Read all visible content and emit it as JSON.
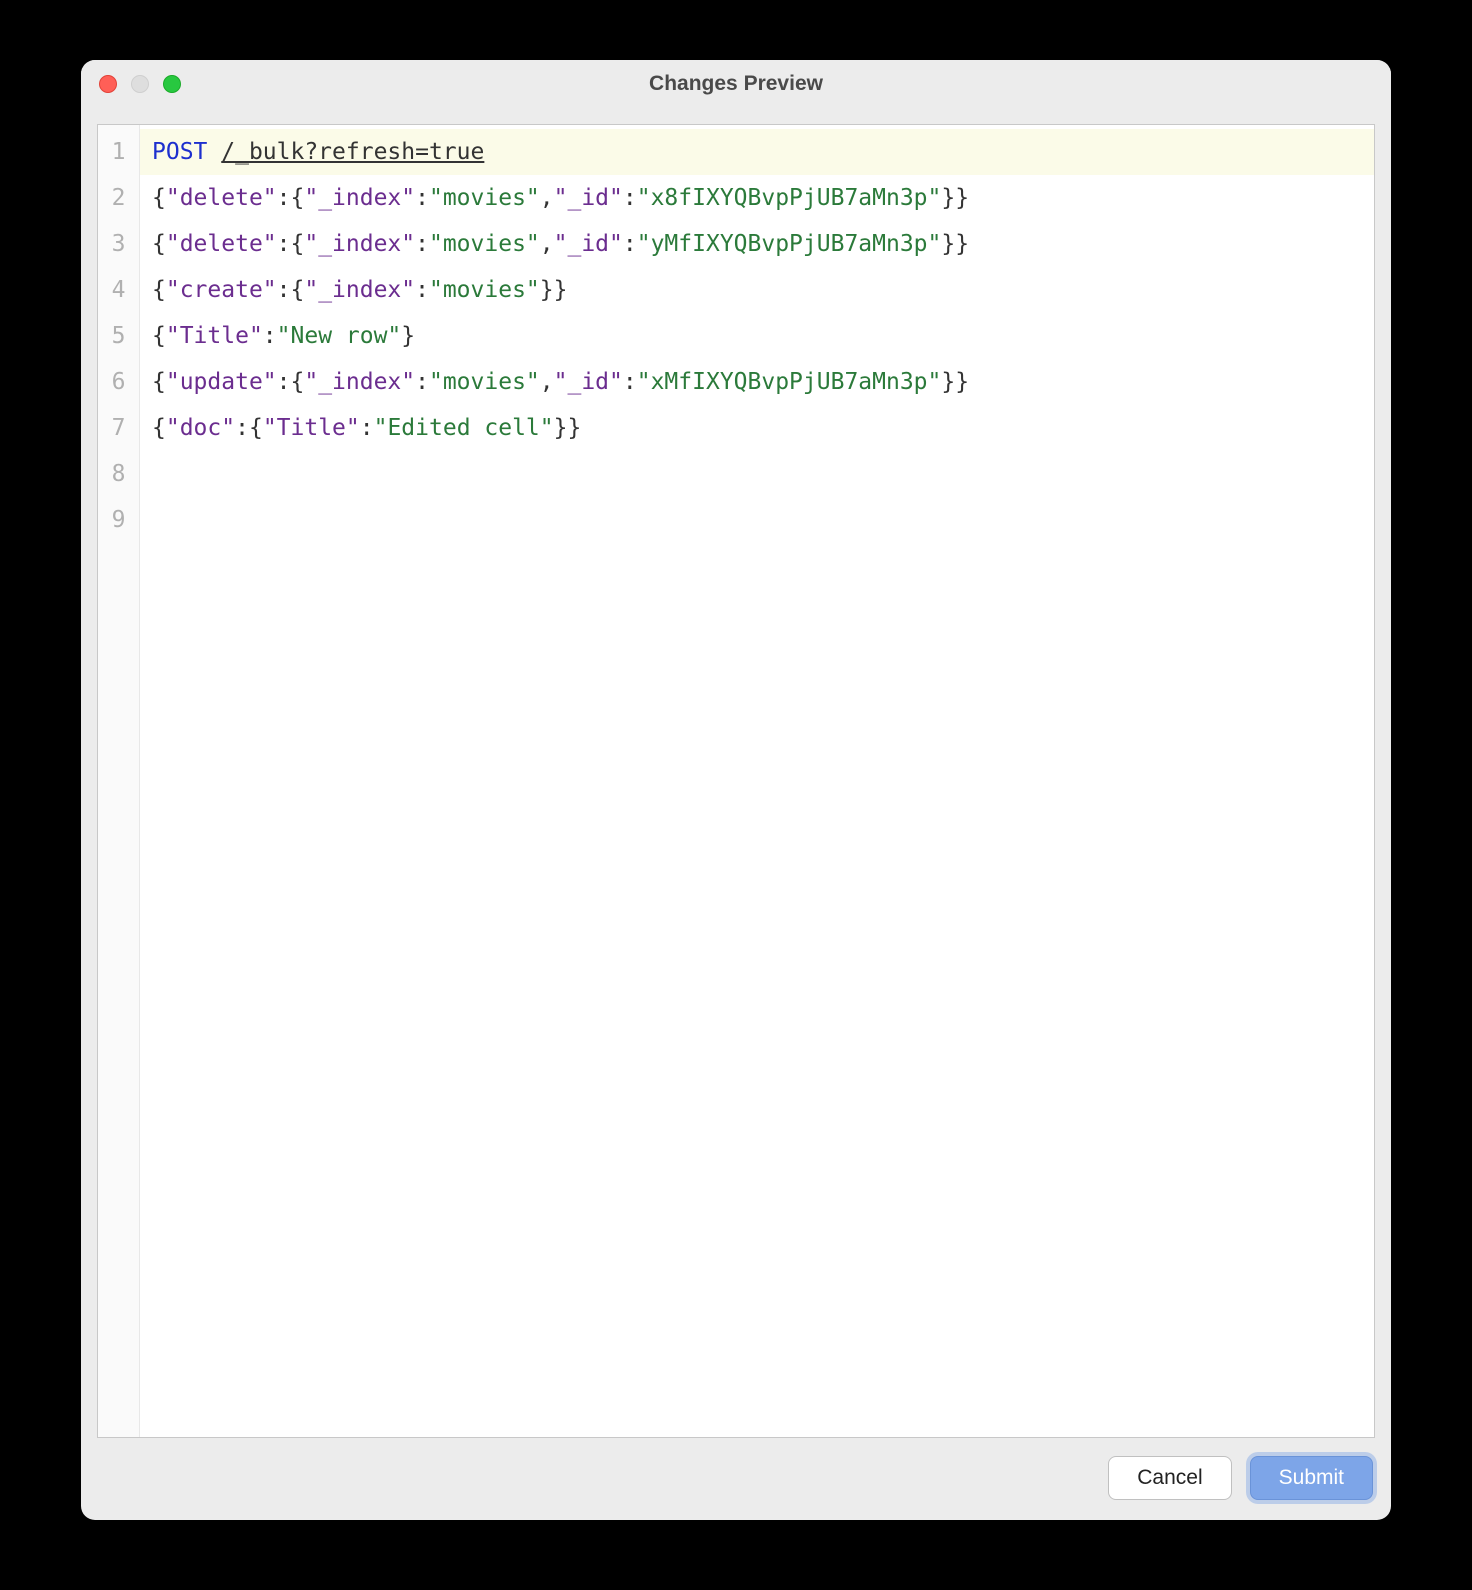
{
  "window": {
    "title": "Changes Preview"
  },
  "editor": {
    "gutter": [
      "1",
      "2",
      "3",
      "4",
      "5",
      "6",
      "7",
      "8",
      "9"
    ],
    "lines": [
      {
        "highlighted": true,
        "tokens": [
          {
            "t": "method",
            "v": "POST"
          },
          {
            "t": "plain",
            "v": " "
          },
          {
            "t": "url",
            "v": "/_bulk?refresh=true"
          }
        ]
      },
      {
        "tokens": [
          {
            "t": "brace",
            "v": "{"
          },
          {
            "t": "key",
            "v": "\"delete\""
          },
          {
            "t": "brace",
            "v": ":{"
          },
          {
            "t": "key",
            "v": "\"_index\""
          },
          {
            "t": "brace",
            "v": ":"
          },
          {
            "t": "string",
            "v": "\"movies\""
          },
          {
            "t": "brace",
            "v": ","
          },
          {
            "t": "key",
            "v": "\"_id\""
          },
          {
            "t": "brace",
            "v": ":"
          },
          {
            "t": "string",
            "v": "\"x8fIXYQBvpPjUB7aMn3p\""
          },
          {
            "t": "brace",
            "v": "}}"
          }
        ]
      },
      {
        "tokens": [
          {
            "t": "brace",
            "v": "{"
          },
          {
            "t": "key",
            "v": "\"delete\""
          },
          {
            "t": "brace",
            "v": ":{"
          },
          {
            "t": "key",
            "v": "\"_index\""
          },
          {
            "t": "brace",
            "v": ":"
          },
          {
            "t": "string",
            "v": "\"movies\""
          },
          {
            "t": "brace",
            "v": ","
          },
          {
            "t": "key",
            "v": "\"_id\""
          },
          {
            "t": "brace",
            "v": ":"
          },
          {
            "t": "string",
            "v": "\"yMfIXYQBvpPjUB7aMn3p\""
          },
          {
            "t": "brace",
            "v": "}}"
          }
        ]
      },
      {
        "tokens": [
          {
            "t": "brace",
            "v": "{"
          },
          {
            "t": "key",
            "v": "\"create\""
          },
          {
            "t": "brace",
            "v": ":{"
          },
          {
            "t": "key",
            "v": "\"_index\""
          },
          {
            "t": "brace",
            "v": ":"
          },
          {
            "t": "string",
            "v": "\"movies\""
          },
          {
            "t": "brace",
            "v": "}}"
          }
        ]
      },
      {
        "tokens": [
          {
            "t": "brace",
            "v": "{"
          },
          {
            "t": "key",
            "v": "\"Title\""
          },
          {
            "t": "brace",
            "v": ":"
          },
          {
            "t": "string",
            "v": "\"New row\""
          },
          {
            "t": "brace",
            "v": "}"
          }
        ]
      },
      {
        "tokens": [
          {
            "t": "brace",
            "v": "{"
          },
          {
            "t": "key",
            "v": "\"update\""
          },
          {
            "t": "brace",
            "v": ":{"
          },
          {
            "t": "key",
            "v": "\"_index\""
          },
          {
            "t": "brace",
            "v": ":"
          },
          {
            "t": "string",
            "v": "\"movies\""
          },
          {
            "t": "brace",
            "v": ","
          },
          {
            "t": "key",
            "v": "\"_id\""
          },
          {
            "t": "brace",
            "v": ":"
          },
          {
            "t": "string",
            "v": "\"xMfIXYQBvpPjUB7aMn3p\""
          },
          {
            "t": "brace",
            "v": "}}"
          }
        ]
      },
      {
        "tokens": [
          {
            "t": "brace",
            "v": "{"
          },
          {
            "t": "key",
            "v": "\"doc\""
          },
          {
            "t": "brace",
            "v": ":{"
          },
          {
            "t": "key",
            "v": "\"Title\""
          },
          {
            "t": "brace",
            "v": ":"
          },
          {
            "t": "string",
            "v": "\"Edited cell\""
          },
          {
            "t": "brace",
            "v": "}}"
          }
        ]
      },
      {
        "tokens": []
      },
      {
        "tokens": []
      }
    ]
  },
  "buttons": {
    "cancel": "Cancel",
    "submit": "Submit"
  }
}
